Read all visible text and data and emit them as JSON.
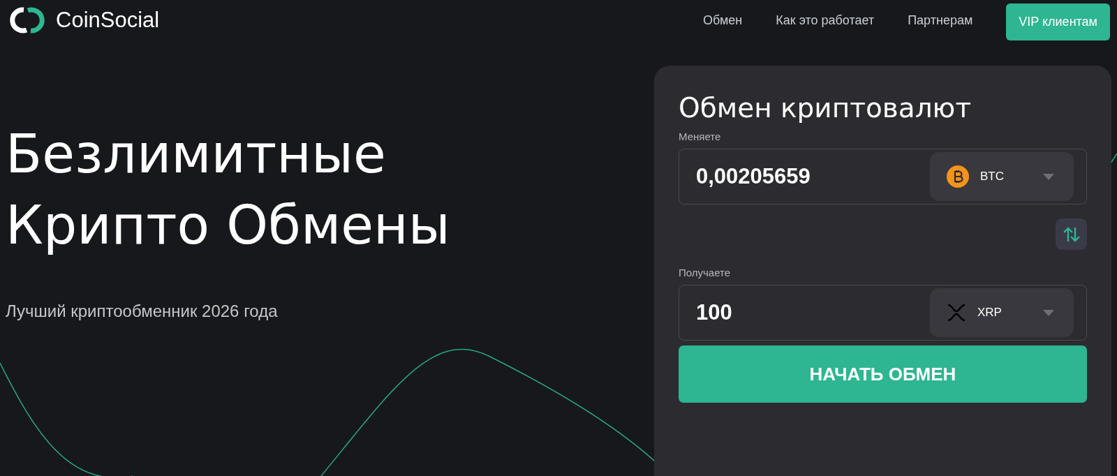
{
  "header": {
    "logo": "CoinSocial",
    "nav": [
      "Обмен",
      "Как это работает",
      "Партнерам"
    ],
    "cta": "VIP клиентам"
  },
  "hero": {
    "headline_lines": [
      "Безлимитные",
      "Крипто Обмены"
    ],
    "subtitle": "Лучший криптообменник 2026 года"
  },
  "exchange": {
    "title": "Обмен криптовалют",
    "fields": [
      {
        "label": "Меняете",
        "value": "0,00205659",
        "currency": "BTC",
        "kind": "btc"
      },
      {
        "label": "Получаете",
        "value": "100",
        "currency": "XRP",
        "kind": "xrp"
      }
    ],
    "submit": "НАЧАТЬ ОБМЕН"
  }
}
